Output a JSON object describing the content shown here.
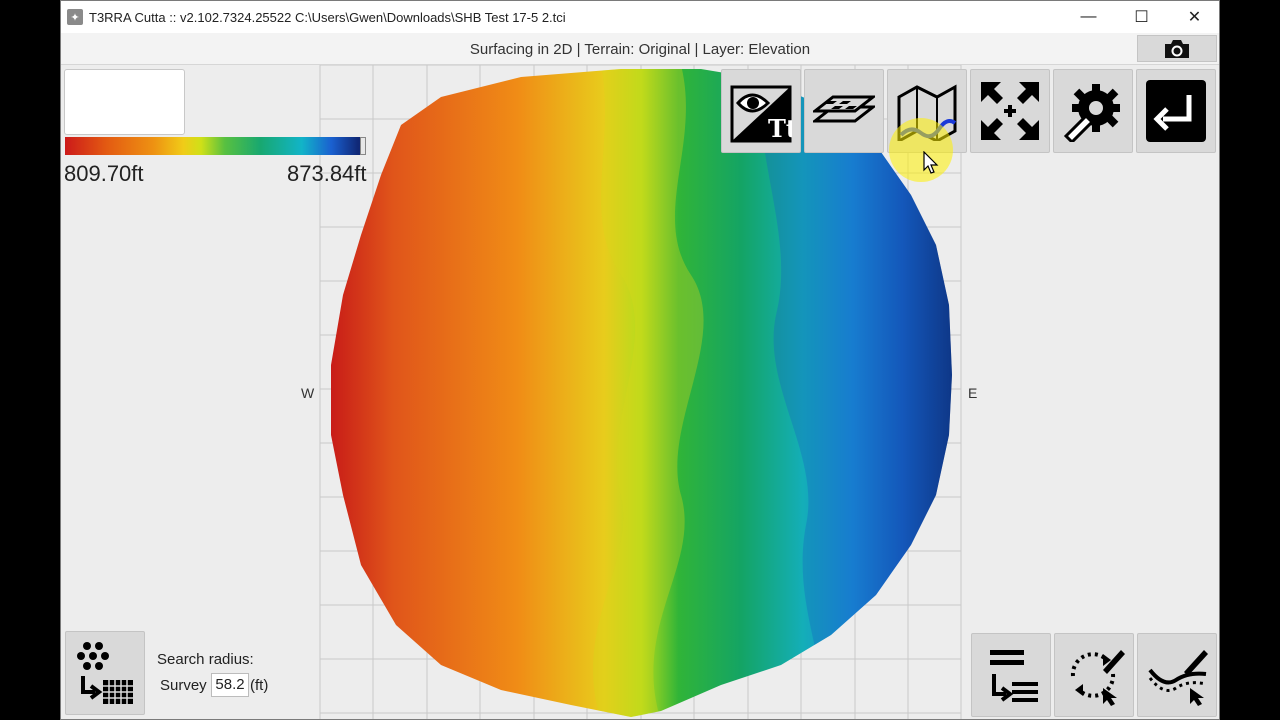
{
  "window": {
    "title": "T3RRA Cutta :: v2.102.7324.25522 C:\\Users\\Gwen\\Downloads\\SHB Test 17-5 2.tci",
    "controls": {
      "minimize": "—",
      "maximize": "☐",
      "close": "✕"
    }
  },
  "status": {
    "text": "Surfacing in 2D | Terrain: Original | Layer: Elevation"
  },
  "legend": {
    "min": "809.70ft",
    "max": "873.84ft"
  },
  "compass": {
    "west": "W",
    "east": "E"
  },
  "toolbar": {
    "top": [
      {
        "name": "view-labels-button",
        "icon": "eye-text-icon"
      },
      {
        "name": "layers-button",
        "icon": "layers-icon"
      },
      {
        "name": "boundary-button",
        "icon": "map-boundary-icon"
      },
      {
        "name": "fit-extents-button",
        "icon": "expand-arrows-icon"
      },
      {
        "name": "settings-button",
        "icon": "gear-wrench-icon"
      },
      {
        "name": "exit-button",
        "icon": "return-arrow-icon"
      }
    ],
    "bottom": [
      {
        "name": "list-options-button",
        "icon": "list-arrow-icon"
      },
      {
        "name": "refresh-edit-button",
        "icon": "refresh-pencil-icon"
      },
      {
        "name": "line-edit-button",
        "icon": "line-pencil-icon"
      }
    ],
    "camera_icon": "camera-icon",
    "grid_button_icon": "points-to-grid-icon"
  },
  "search": {
    "label": "Search radius:",
    "survey_label": "Survey",
    "value": "58.2",
    "unit": "(ft)"
  },
  "colors": {
    "window_bg": "#ededed",
    "button_bg": "#d9d9d9",
    "icon_black": "#000000",
    "highlight": "#fff000"
  }
}
